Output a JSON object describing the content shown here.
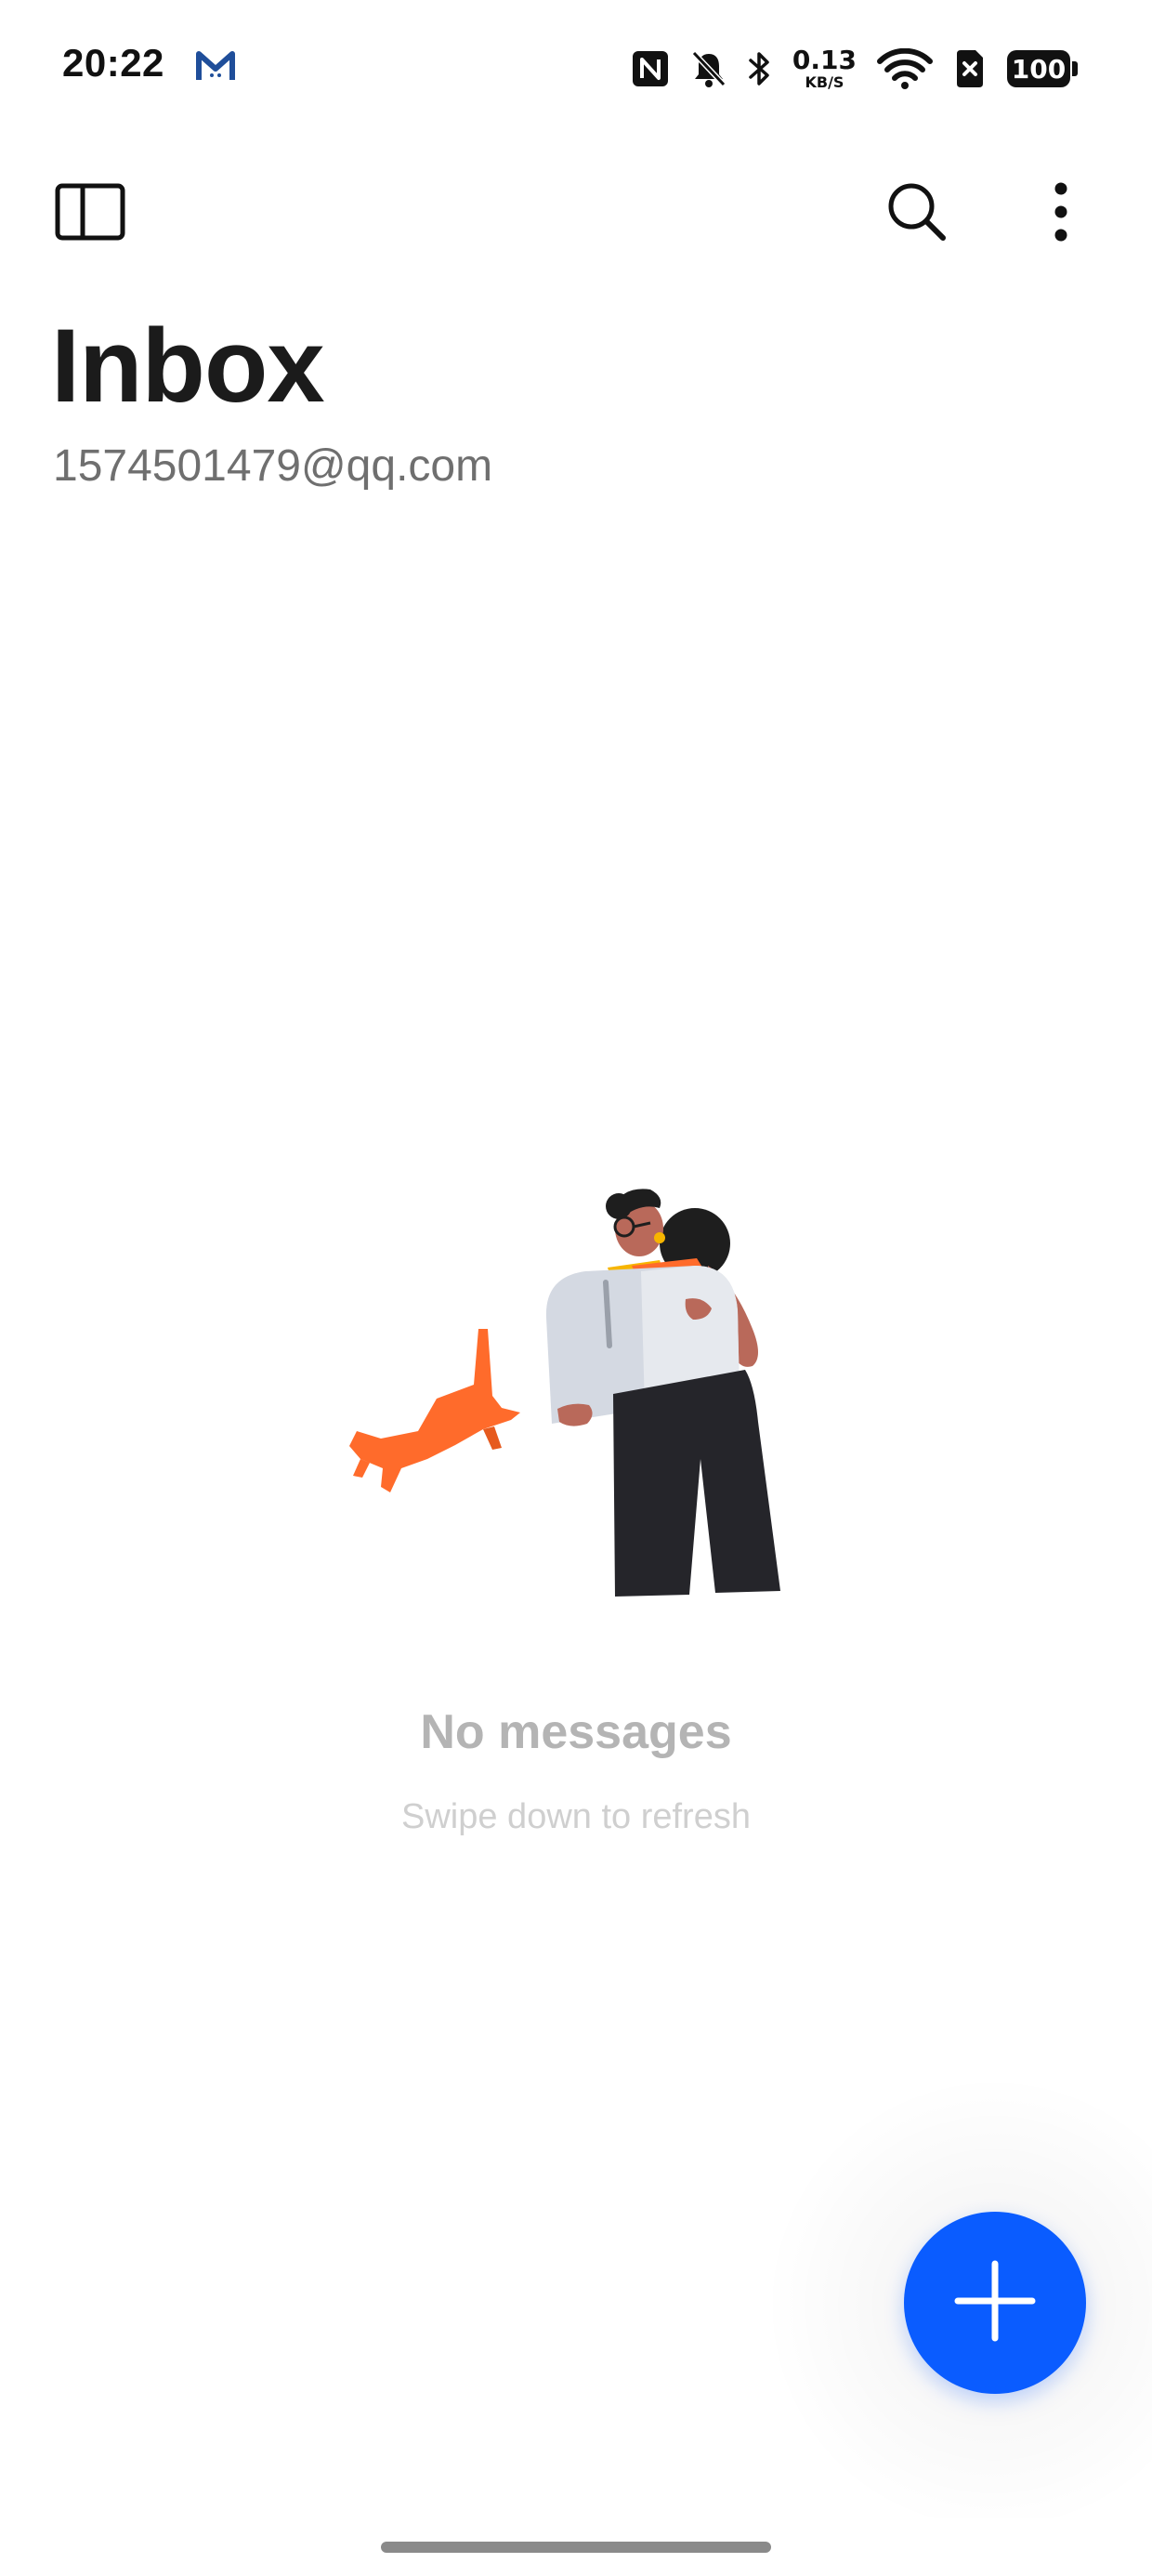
{
  "status_bar": {
    "time": "20:22",
    "net_speed_value": "0.13",
    "net_speed_unit": "KB/S",
    "battery_level": "100",
    "icons": [
      "mail-app-notification-icon",
      "nfc-icon",
      "bell-muted-icon",
      "bluetooth-icon",
      "net-speed-indicator",
      "wifi-icon",
      "sim-x-icon",
      "battery-icon"
    ]
  },
  "toolbar": {
    "icons": [
      "drawer-toggle-icon",
      "search-icon",
      "more-vert-icon"
    ]
  },
  "header": {
    "title": "Inbox",
    "account_email": "1574501479@qq.com"
  },
  "empty_state": {
    "title": "No messages",
    "subtitle": "Swipe down to refresh"
  },
  "fab": {
    "icon": "plus-icon"
  },
  "colors": {
    "accent": "#0a5cff",
    "title_text": "#1b1b1b",
    "email_text": "#6f6f6f",
    "empty_title": "#b4b4b4",
    "empty_sub": "#cfcfcf",
    "cat": "#ff6b2b",
    "pants": "#25252a",
    "mailbox": "#d4d9e2"
  }
}
